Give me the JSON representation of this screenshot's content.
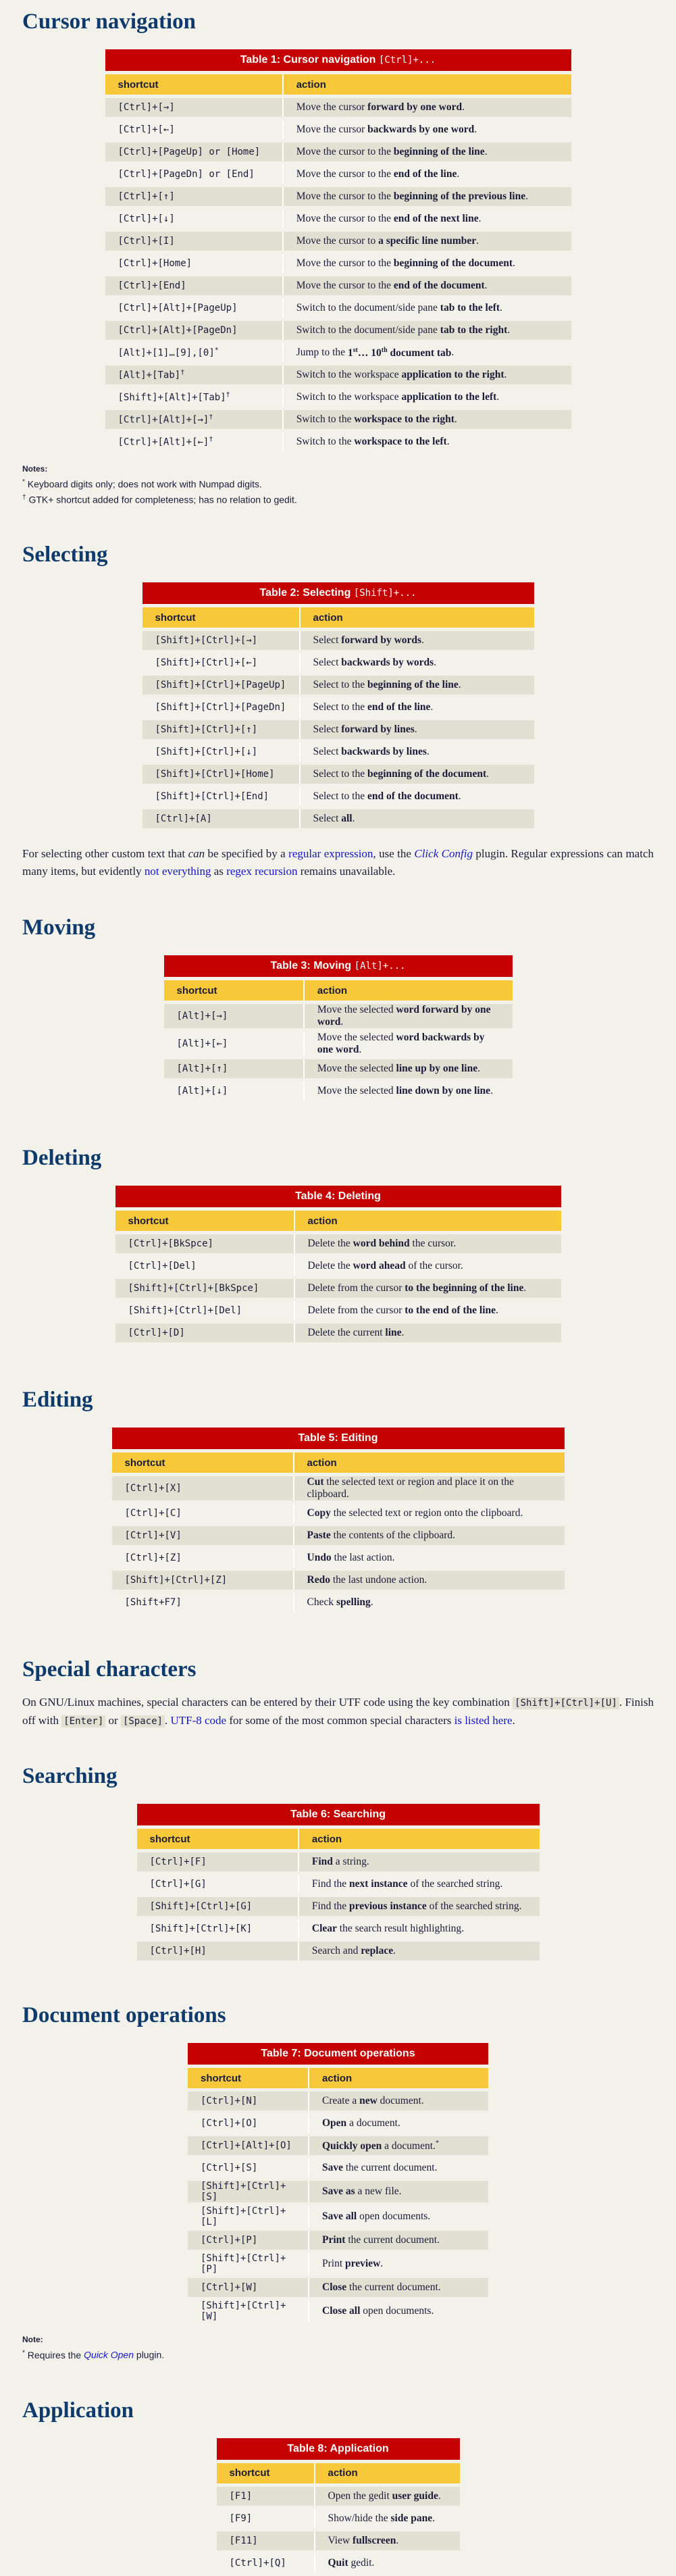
{
  "sections": {
    "cursor": {
      "title": "Cursor navigation",
      "caption_text": "Table 1: Cursor navigation ",
      "caption_code": "[Ctrl]+...",
      "headers": [
        "shortcut",
        "action"
      ],
      "rows": [
        [
          "[Ctrl]+[→]",
          "Move the cursor ",
          "forward by one word",
          "."
        ],
        [
          "[Ctrl]+[←]",
          "Move the cursor ",
          "backwards by one word",
          "."
        ],
        [
          "[Ctrl]+[PageUp] or [Home]",
          "Move the cursor to the ",
          "beginning of the line",
          "."
        ],
        [
          "[Ctrl]+[PageDn] or [End]",
          "Move the cursor to the ",
          "end of the line",
          "."
        ],
        [
          "[Ctrl]+[↑]",
          "Move the cursor to the ",
          "beginning of the previous line",
          "."
        ],
        [
          "[Ctrl]+[↓]",
          "Move the cursor to the ",
          "end of the next line",
          "."
        ],
        [
          "[Ctrl]+[I]",
          "Move the cursor to ",
          "a specific line number",
          "."
        ],
        [
          "[Ctrl]+[Home]",
          "Move the cursor to the ",
          "beginning of the document",
          "."
        ],
        [
          "[Ctrl]+[End]",
          "Move the cursor to the ",
          "end of the document",
          "."
        ],
        [
          "[Ctrl]+[Alt]+[PageUp]",
          "Switch to the document/side pane ",
          "tab to the left",
          "."
        ],
        [
          "[Ctrl]+[Alt]+[PageDn]",
          "Switch to the document/side pane ",
          "tab to the right",
          "."
        ],
        [
          "[Alt]+[1]…[9],[0]*",
          "Jump to the ",
          "1st… 10th document tab",
          "."
        ],
        [
          "[Alt]+[Tab]†",
          "Switch to the workspace ",
          "application to the right",
          "."
        ],
        [
          "[Shift]+[Alt]+[Tab]†",
          "Switch to the workspace ",
          "application to the left",
          "."
        ],
        [
          "[Ctrl]+[Alt]+[→]†",
          "Switch to the ",
          "workspace to the right",
          "."
        ],
        [
          "[Ctrl]+[Alt]+[←]†",
          "Switch to the ",
          "workspace to the left",
          "."
        ]
      ],
      "notes_label": "Notes:",
      "notes": [
        "* Keyboard digits only; does not work with Numpad digits.",
        "† GTK+ shortcut added for completeness; has no relation to gedit."
      ]
    },
    "selecting": {
      "title": "Selecting",
      "caption_text": "Table 2: Selecting ",
      "caption_code": "[Shift]+...",
      "headers": [
        "shortcut",
        "action"
      ],
      "rows": [
        [
          "[Shift]+[Ctrl]+[→]",
          "Select ",
          "forward by words",
          "."
        ],
        [
          "[Shift]+[Ctrl]+[←]",
          "Select ",
          "backwards by words",
          "."
        ],
        [
          "[Shift]+[Ctrl]+[PageUp]",
          "Select to the ",
          "beginning of the line",
          "."
        ],
        [
          "[Shift]+[Ctrl]+[PageDn]",
          "Select to the ",
          "end of the line",
          "."
        ],
        [
          "[Shift]+[Ctrl]+[↑]",
          "Select ",
          "forward by lines",
          "."
        ],
        [
          "[Shift]+[Ctrl]+[↓]",
          "Select ",
          "backwards by lines",
          "."
        ],
        [
          "[Shift]+[Ctrl]+[Home]",
          "Select to the ",
          "beginning of the document",
          "."
        ],
        [
          "[Shift]+[Ctrl]+[End]",
          "Select to the ",
          "end of the document",
          "."
        ],
        [
          "[Ctrl]+[A]",
          "Select ",
          "all",
          "."
        ]
      ],
      "para": {
        "p1": "For selecting other custom text that ",
        "can": "can",
        "p2": " be specified by a ",
        "link1": "regular expression",
        "p3": ", use the ",
        "link2": "Click Config",
        "p4": " plugin. Regular expressions can match many items, but evidently ",
        "link3": "not everything",
        "p5": " as ",
        "link4": "regex recursion",
        "p6": " remains unavailable."
      }
    },
    "moving": {
      "title": "Moving",
      "caption_text": "Table 3: Moving ",
      "caption_code": "[Alt]+...",
      "headers": [
        "shortcut",
        "action"
      ],
      "rows": [
        [
          "[Alt]+[→]",
          "Move the selected ",
          "word forward by one word",
          "."
        ],
        [
          "[Alt]+[←]",
          "Move the selected ",
          "word backwards by one word",
          "."
        ],
        [
          "[Alt]+[↑]",
          "Move the selected ",
          "line up by one line",
          "."
        ],
        [
          "[Alt]+[↓]",
          "Move the selected ",
          "line down by one line",
          "."
        ]
      ]
    },
    "deleting": {
      "title": "Deleting",
      "caption_text": "Table 4: Deleting",
      "caption_code": "",
      "headers": [
        "shortcut",
        "action"
      ],
      "rows": [
        [
          "[Ctrl]+[BkSpce]",
          "Delete the ",
          "word behind",
          " the cursor."
        ],
        [
          "[Ctrl]+[Del]",
          "Delete the ",
          "word ahead",
          " of the cursor."
        ],
        [
          "[Shift]+[Ctrl]+[BkSpce]",
          "Delete from the cursor ",
          "to the beginning of the line",
          "."
        ],
        [
          "[Shift]+[Ctrl]+[Del]",
          "Delete from the cursor ",
          "to the end of the line",
          "."
        ],
        [
          "[Ctrl]+[D]",
          "Delete the current ",
          "line",
          "."
        ]
      ]
    },
    "editing": {
      "title": "Editing",
      "caption_text": "Table 5: Editing",
      "caption_code": "",
      "headers": [
        "shortcut",
        "action"
      ],
      "rows": [
        [
          "[Ctrl]+[X]",
          "",
          "Cut",
          " the selected text or region and place it on the clipboard."
        ],
        [
          "[Ctrl]+[C]",
          "",
          "Copy",
          " the selected text or region onto the clipboard."
        ],
        [
          "[Ctrl]+[V]",
          "",
          "Paste",
          " the contents of the clipboard."
        ],
        [
          "[Ctrl]+[Z]",
          "",
          "Undo",
          " the last action."
        ],
        [
          "[Shift]+[Ctrl]+[Z]",
          "",
          "Redo",
          " the last undone action."
        ],
        [
          "[Shift+F7]",
          "Check ",
          "spelling",
          "."
        ]
      ]
    },
    "special": {
      "title": "Special characters",
      "p1": "On GNU/Linux machines, special characters can be entered by their UTF code using the key combination ",
      "k1": "[Shift]+[Ctrl]+[U]",
      "p2": ". Finish off with ",
      "k2": "[Enter]",
      "p3": " or ",
      "k3": "[Space]",
      "p4": ". ",
      "link1": "UTF-8 code",
      "p5": " for some of the most common special characters ",
      "link2": "is listed here",
      "p6": "."
    },
    "searching": {
      "title": "Searching",
      "caption_text": "Table 6: Searching",
      "caption_code": "",
      "headers": [
        "shortcut",
        "action"
      ],
      "rows": [
        [
          "[Ctrl]+[F]",
          "",
          "Find",
          " a string."
        ],
        [
          "[Ctrl]+[G]",
          "Find the ",
          "next instance",
          " of the searched string."
        ],
        [
          "[Shift]+[Ctrl]+[G]",
          "Find the ",
          "previous instance",
          " of the searched string."
        ],
        [
          "[Shift]+[Ctrl]+[K]",
          "",
          "Clear",
          " the search result highlighting."
        ],
        [
          "[Ctrl]+[H]",
          "Search and ",
          "replace",
          "."
        ]
      ]
    },
    "docops": {
      "title": "Document operations",
      "caption_text": "Table 7: Document operations",
      "caption_code": "",
      "headers": [
        "shortcut",
        "action"
      ],
      "rows": [
        [
          "[Ctrl]+[N]",
          "Create a ",
          "new",
          " document."
        ],
        [
          "[Ctrl]+[O]",
          "",
          "Open",
          " a document."
        ],
        [
          "[Ctrl]+[Alt]+[O]",
          "",
          "Quickly open",
          " a document.*"
        ],
        [
          "[Ctrl]+[S]",
          "",
          "Save",
          " the current document."
        ],
        [
          "[Shift]+[Ctrl]+[S]",
          "",
          "Save as",
          " a new file."
        ],
        [
          "[Shift]+[Ctrl]+[L]",
          "",
          "Save all",
          " open documents."
        ],
        [
          "[Ctrl]+[P]",
          "",
          "Print",
          " the current document."
        ],
        [
          "[Shift]+[Ctrl]+[P]",
          "Print ",
          "preview",
          "."
        ],
        [
          "[Ctrl]+[W]",
          "",
          "Close",
          " the current document."
        ],
        [
          "[Shift]+[Ctrl]+[W]",
          "",
          "Close all",
          " open documents."
        ]
      ],
      "notes_label": "Note:",
      "note_pre": "* Requires the ",
      "note_link": "Quick Open",
      "note_post": " plugin."
    },
    "application": {
      "title": "Application",
      "caption_text": "Table 8: Application",
      "caption_code": "",
      "headers": [
        "shortcut",
        "action"
      ],
      "rows": [
        [
          "[F1]",
          "Open the gedit ",
          "user guide",
          "."
        ],
        [
          "[F9]",
          "Show/hide the ",
          "side pane",
          "."
        ],
        [
          "[F11]",
          "View ",
          "fullscreen",
          "."
        ],
        [
          "[Ctrl]+[Q]",
          "",
          "Quit",
          " gedit."
        ]
      ]
    }
  }
}
